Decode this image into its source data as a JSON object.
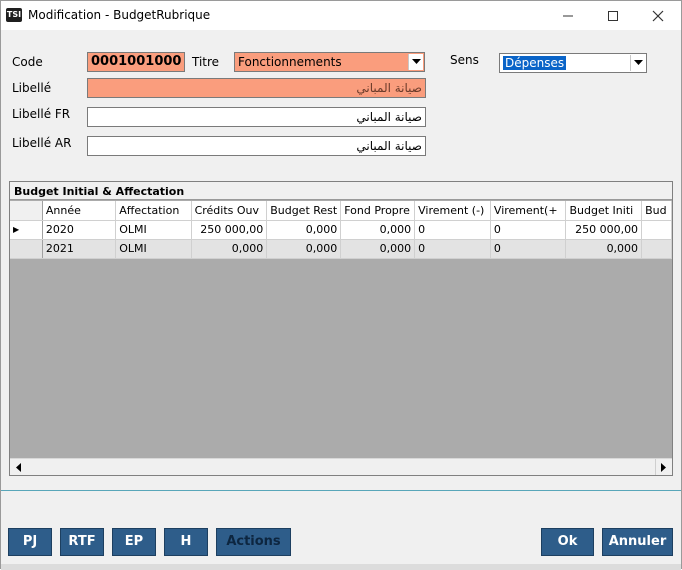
{
  "window": {
    "title": "Modification - BudgetRubrique",
    "icon_text": "TSI"
  },
  "form": {
    "code_label": "Code",
    "code_value": "0001001000",
    "titre_label": "Titre",
    "titre_value": "Fonctionnements",
    "sens_label": "Sens",
    "sens_value": "Dépenses",
    "libelle_label": "Libellé",
    "libelle_value": "صيانة المباني",
    "libelle_fr_label": "Libellé FR",
    "libelle_fr_value": "صيانة المباني",
    "libelle_ar_label": "Libellé AR",
    "libelle_ar_value": "صيانة المباني"
  },
  "grid": {
    "caption": "Budget Initial & Affectation",
    "columns": [
      "Année",
      "Affectation",
      "Crédits Ouv",
      "Budget Rest",
      "Fond Propre",
      "Virement (-)",
      "Virement(+",
      "Budget Initi",
      "Bud"
    ],
    "rows": [
      [
        "2020",
        "OLMI",
        "250 000,00",
        "0,000",
        "0,000",
        "0",
        "0",
        "250 000,00",
        ""
      ],
      [
        "2021",
        "OLMI",
        "0,000",
        "0,000",
        "0,000",
        "0",
        "0",
        "0,000",
        ""
      ]
    ],
    "current_row_marker": "▶"
  },
  "buttons": {
    "pj": "PJ",
    "rtf": "RTF",
    "ep": "EP",
    "h": "H",
    "actions": "Actions",
    "ok": "Ok",
    "annuler": "Annuler"
  },
  "colors": {
    "required_field": "#fa9d7d",
    "button_bg": "#2e5d8a",
    "selection": "#0a64c8"
  }
}
